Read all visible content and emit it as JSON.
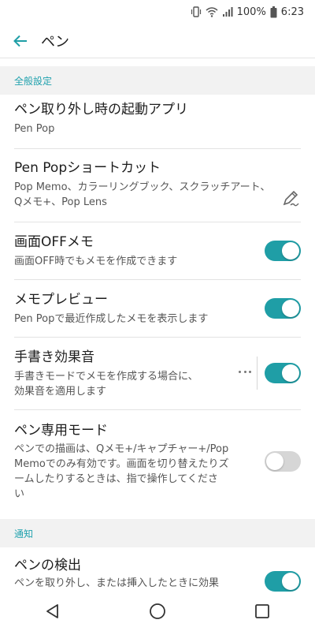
{
  "status_bar": {
    "battery": "100%",
    "time": "6:23",
    "icons": [
      "vibrate-icon",
      "wifi-icon",
      "signal-icon",
      "battery-icon"
    ]
  },
  "app_bar": {
    "title": "ペン",
    "back_icon": "arrow-left-icon"
  },
  "accent_color": "#1f9ea6",
  "sections": {
    "general": "全般設定",
    "notify": "通知"
  },
  "items": {
    "launch_app": {
      "title": "ペン取り外し時の起動アプリ",
      "subtitle": "Pen Pop"
    },
    "shortcut": {
      "title": "Pen Popショートカット",
      "subtitle_line1": "Pop Memo、カラーリングブック、スクラッチアート、",
      "subtitle_line2": "Qメモ+、Pop Lens",
      "icon": "pen-edit-icon"
    },
    "screen_off": {
      "title": "画面OFFメモ",
      "subtitle": "画面OFF時でもメモを作成できます",
      "enabled": true
    },
    "memo_preview": {
      "title": "メモプレビュー",
      "subtitle": "Pen Popで最近作成したメモを表示します",
      "enabled": true
    },
    "handwriting_sound": {
      "title": "手書き効果音",
      "subtitle_line1": "手書きモードでメモを作成する場合に、",
      "subtitle_line2": "効果音を適用します",
      "more_icon": "more-horizontal-icon",
      "enabled": true
    },
    "pen_only": {
      "title": "ペン専用モード",
      "subtitle_line1": "ペンでの描画は、Qメモ+/キャプチャー+/Pop",
      "subtitle_line2": "Memoでのみ有効です。画面を切り替えたりズ",
      "subtitle_line3": "ームしたりするときは、指で操作してくださ",
      "subtitle_line4": "い",
      "enabled": false
    },
    "pen_detect": {
      "title": "ペンの検出",
      "subtitle": "ペンを取り外し、または挿入したときに効果",
      "enabled": true
    }
  },
  "nav_bar": {
    "back": "triangle-back-icon",
    "home": "circle-home-icon",
    "recents": "square-recents-icon"
  }
}
